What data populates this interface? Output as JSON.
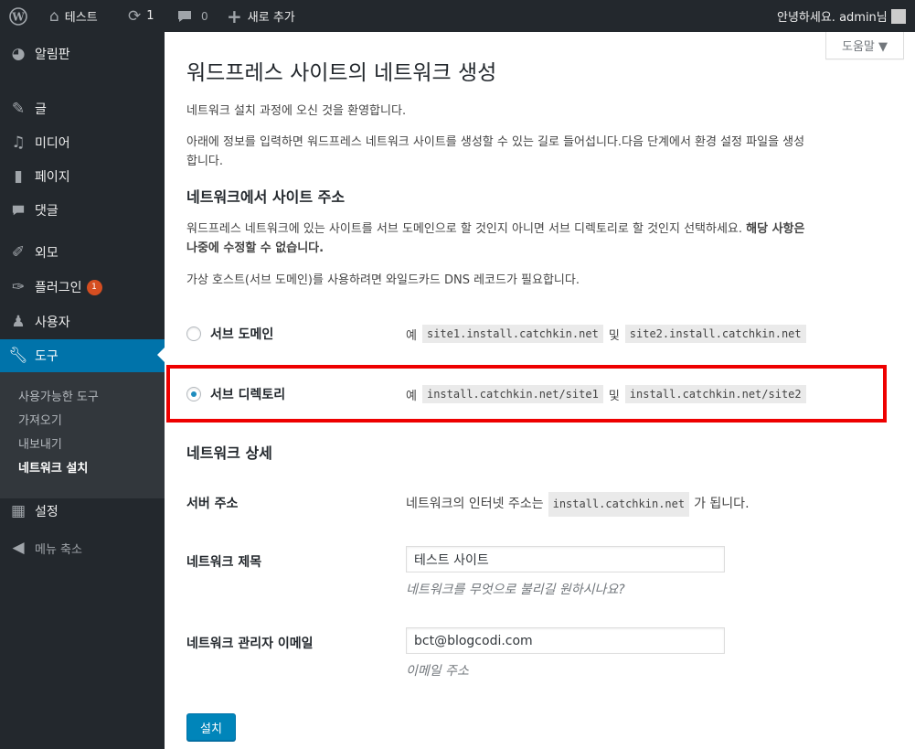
{
  "admin_bar": {
    "site_name": "테스트",
    "updates_count": "1",
    "comments_count": "0",
    "new_label": "새로 추가",
    "greeting": "안녕하세요. admin님"
  },
  "help_tab": {
    "label": "도움말 ▼"
  },
  "sidebar": {
    "items": [
      {
        "label": "알림판",
        "icon": "dashboard-icon"
      },
      {
        "label": "글",
        "icon": "pin-icon"
      },
      {
        "label": "미디어",
        "icon": "media-icon"
      },
      {
        "label": "페이지",
        "icon": "page-icon"
      },
      {
        "label": "댓글",
        "icon": "comment-icon"
      },
      {
        "label": "외모",
        "icon": "appearance-icon"
      },
      {
        "label": "플러그인",
        "icon": "plugin-icon",
        "badge": "1"
      },
      {
        "label": "사용자",
        "icon": "user-icon"
      },
      {
        "label": "도구",
        "icon": "wrench-icon"
      }
    ],
    "submenu": [
      "사용가능한 도구",
      "가져오기",
      "내보내기",
      "네트워크 설치"
    ],
    "settings_label": "설정",
    "collapse_label": "메뉴 축소"
  },
  "main": {
    "title": "워드프레스 사이트의 네트워크 생성",
    "welcome": "네트워크 설치 과정에 오신 것을 환영합니다.",
    "intro_line1": "아래에 정보를 입력하면 워드프레스 네트워크 사이트를 생성할 수 있는 길로 들어섭니다.다음 단계에서 환경 설정 파일을 생성",
    "intro_line2": "합니다.",
    "addresses_heading": "네트워크에서 사이트 주소",
    "addresses_desc1": "워드프레스 네트워크에 있는 사이트를 서브 도메인으로 할 것인지 아니면 서브 디렉토리로 할 것인지 선택하세요. ",
    "addresses_desc1_bold": "해당 사항은",
    "addresses_desc2_bold": "나중에 수정할 수 없습니다.",
    "wildcard_note": "가상 호스트(서브 도메인)를 사용하려면 와일드카드 DNS 레코드가 필요합니다.",
    "subdomain": {
      "label": "서브 도메인",
      "example_prefix": "예",
      "example1": "site1.install.catchkin.net",
      "joiner": "및",
      "example2": "site2.install.catchkin.net",
      "checked": false
    },
    "subdirectory": {
      "label": "서브 디렉토리",
      "example_prefix": "예",
      "example1": "install.catchkin.net/site1",
      "joiner": "및",
      "example2": "install.catchkin.net/site2",
      "checked": true
    },
    "details_heading": "네트워크 상세",
    "server_address_label": "서버 주소",
    "server_address_prefix": "네트워크의 인터넷 주소는",
    "server_address_value": "install.catchkin.net",
    "server_address_suffix": "가 됩니다.",
    "network_title_label": "네트워크 제목",
    "network_title_value": "테스트 사이트",
    "network_title_desc": "네트워크를 무엇으로 불리길 원하시나요?",
    "admin_email_label": "네트워크 관리자 이메일",
    "admin_email_value": "bct@blogcodi.com",
    "admin_email_desc": "이메일 주소",
    "install_button": "설치"
  },
  "colors": {
    "admin_bar": "#23282d",
    "accent": "#0073aa",
    "highlight_box": "#e00000",
    "badge": "#d54e21"
  }
}
